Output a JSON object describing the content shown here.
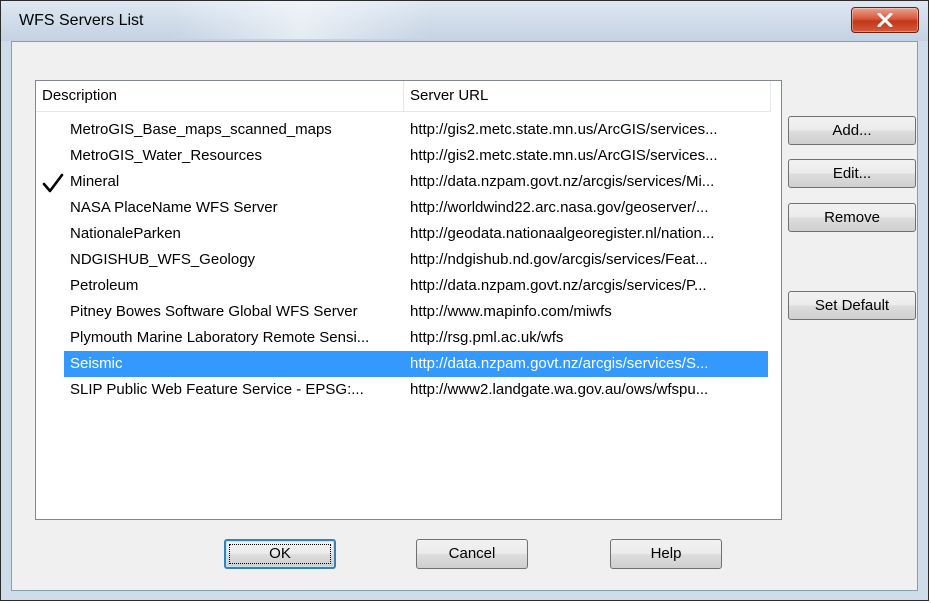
{
  "window": {
    "title": "WFS Servers List"
  },
  "list": {
    "columns": {
      "description": "Description",
      "server_url": "Server URL"
    },
    "rows": [
      {
        "description": "MetroGIS_Base_maps_scanned_maps",
        "url": "http://gis2.metc.state.mn.us/ArcGIS/services...",
        "default": false,
        "selected": false
      },
      {
        "description": "MetroGIS_Water_Resources",
        "url": "http://gis2.metc.state.mn.us/ArcGIS/services...",
        "default": false,
        "selected": false
      },
      {
        "description": "Mineral",
        "url": "http://data.nzpam.govt.nz/arcgis/services/Mi...",
        "default": true,
        "selected": false
      },
      {
        "description": "NASA PlaceName WFS Server",
        "url": "http://worldwind22.arc.nasa.gov/geoserver/...",
        "default": false,
        "selected": false
      },
      {
        "description": "NationaleParken",
        "url": "http://geodata.nationaalgeoregister.nl/nation...",
        "default": false,
        "selected": false
      },
      {
        "description": "NDGISHUB_WFS_Geology",
        "url": "http://ndgishub.nd.gov/arcgis/services/Feat...",
        "default": false,
        "selected": false
      },
      {
        "description": "Petroleum",
        "url": "http://data.nzpam.govt.nz/arcgis/services/P...",
        "default": false,
        "selected": false
      },
      {
        "description": "Pitney Bowes Software Global WFS Server",
        "url": "http://www.mapinfo.com/miwfs",
        "default": false,
        "selected": false
      },
      {
        "description": "Plymouth Marine Laboratory Remote Sensi...",
        "url": "http://rsg.pml.ac.uk/wfs",
        "default": false,
        "selected": false
      },
      {
        "description": "Seismic",
        "url": "http://data.nzpam.govt.nz/arcgis/services/S...",
        "default": false,
        "selected": true
      },
      {
        "description": "SLIP Public Web Feature Service - EPSG:...",
        "url": "http://www2.landgate.wa.gov.au/ows/wfspu...",
        "default": false,
        "selected": false
      }
    ]
  },
  "buttons": {
    "add": "Add...",
    "edit": "Edit...",
    "remove": "Remove",
    "set_default": "Set Default",
    "ok": "OK",
    "cancel": "Cancel",
    "help": "Help"
  },
  "colors": {
    "selection": "#3399ff",
    "close_button": "#c9452a"
  },
  "icons": {
    "close": "close-icon",
    "default_marker": "checkmark-icon"
  }
}
